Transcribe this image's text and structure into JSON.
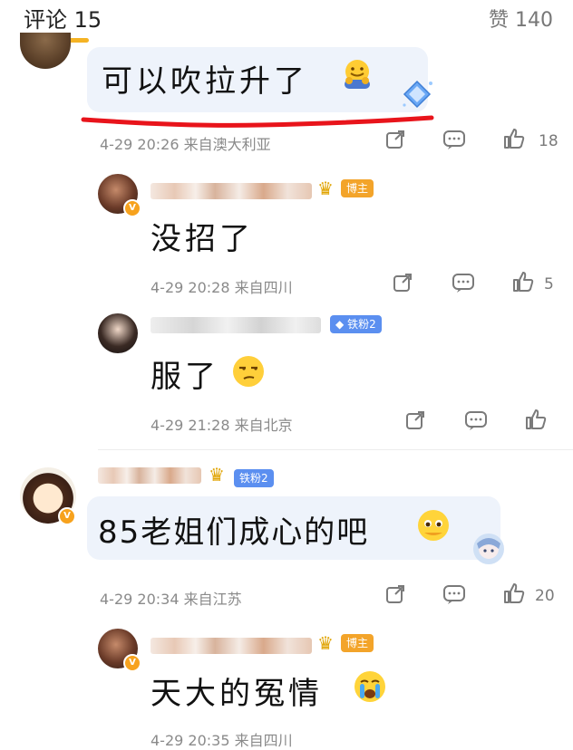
{
  "header": {
    "comments_label": "评论 15",
    "likes_label": "赞 140"
  },
  "comments": [
    {
      "text": "可以吹拉升了",
      "time": "4-29 20:26 来自澳大利亚",
      "likes": "18"
    },
    {
      "tag": "博主",
      "text": "没招了",
      "time": "4-29 20:28 来自四川",
      "likes": "5"
    },
    {
      "tag": "铁粉2",
      "text": "服了",
      "time": "4-29 21:28 来自北京",
      "likes": ""
    },
    {
      "tag": "铁粉2",
      "text": "85老姐们成心的吧",
      "time": "4-29 20:34 来自江苏",
      "likes": "20"
    },
    {
      "tag": "博主",
      "text": "天大的冤情",
      "time": "4-29 20:35 来自四川",
      "likes": ""
    }
  ],
  "colors": {
    "accent_underline": "#f5b324",
    "red_annotation": "#e8141b",
    "host_tag": "#f3a42a",
    "fan_tag": "#5b8ff0"
  },
  "icons": [
    "share-icon",
    "comment-icon",
    "thumbs-up-icon",
    "crown-icon",
    "verified-badge-icon"
  ]
}
